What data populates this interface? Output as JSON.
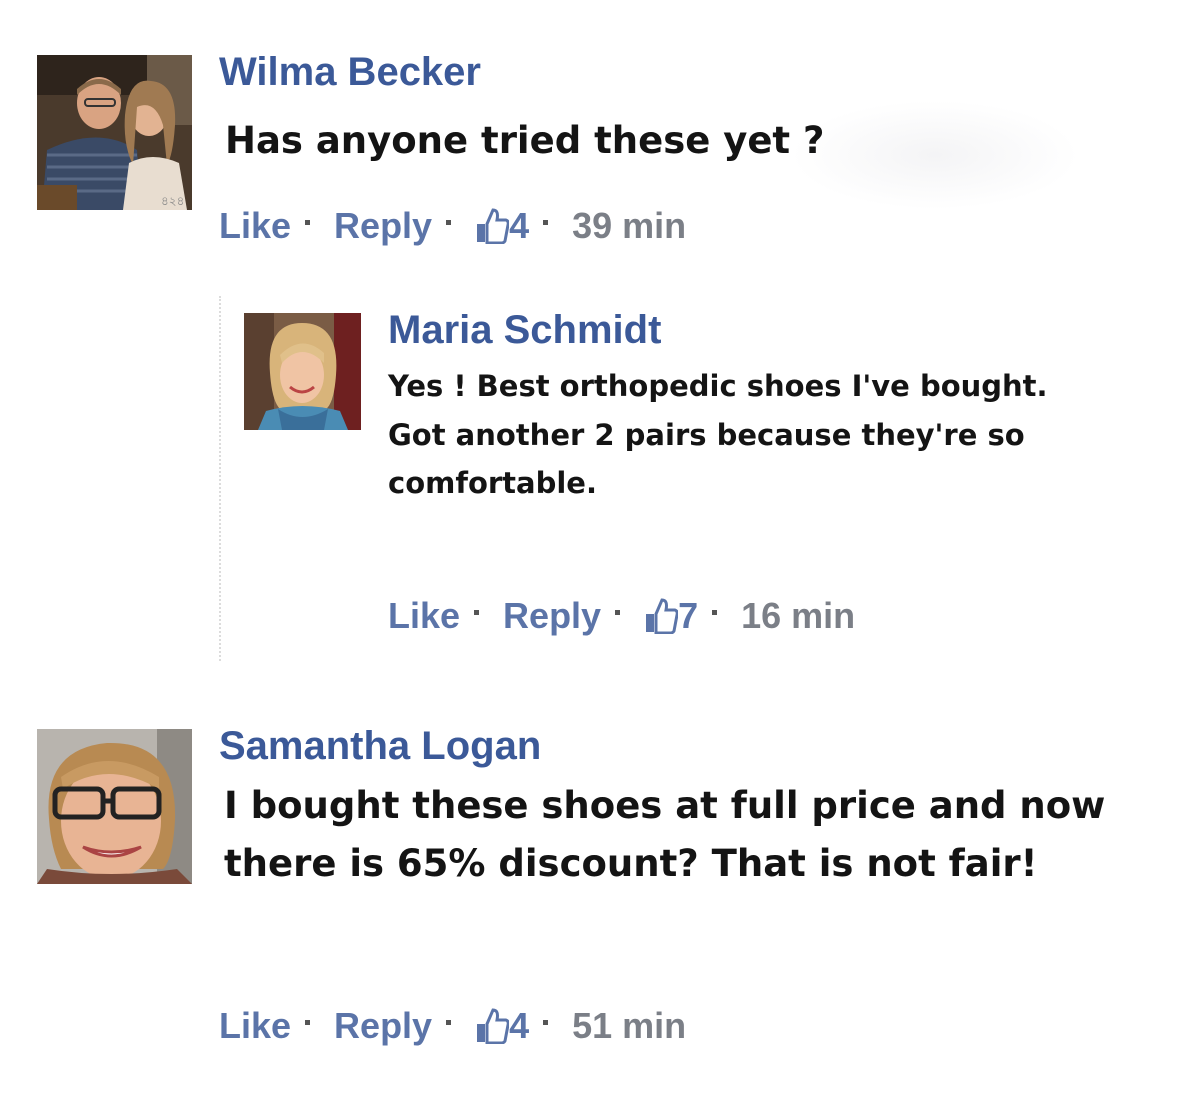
{
  "comments": [
    {
      "author": "Wilma Becker",
      "text": "Has anyone tried these yet ?",
      "like_label": "Like",
      "reply_label": "Reply",
      "like_count": "4",
      "time": "39 min"
    },
    {
      "author": "Maria Schmidt",
      "text": "Yes ! Best orthopedic shoes I've bought. Got another 2 pairs because they're so comfortable.",
      "like_label": "Like",
      "reply_label": "Reply",
      "like_count": "7",
      "time": "16 min"
    },
    {
      "author": "Samantha Logan",
      "text": "I bought these shoes at full price and now there is 65% discount? That is not fair!",
      "like_label": "Like",
      "reply_label": "Reply",
      "like_count": "4",
      "time": "51 min"
    }
  ],
  "colors": {
    "author_name": "#3b5998",
    "action_link": "#5b74a8",
    "timestamp": "#7b7f87",
    "comment_text": "#141414"
  },
  "icons": {
    "like_count_icon": "thumbs-up-icon"
  }
}
